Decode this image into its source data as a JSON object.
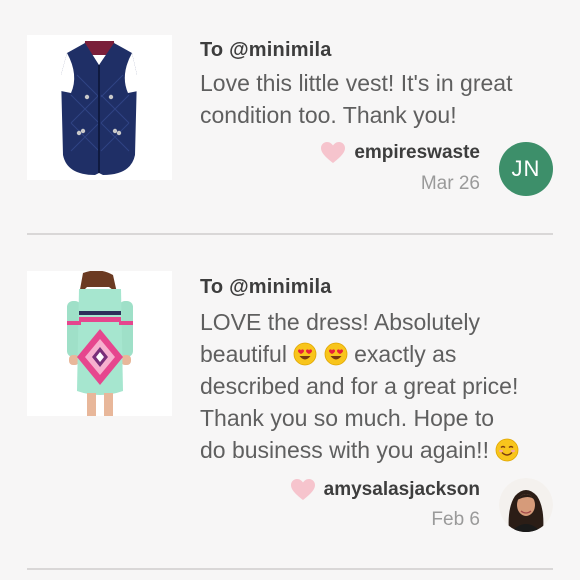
{
  "reviews": [
    {
      "to": "To @minimila",
      "message_lines": [
        "Love this little vest! It's in great",
        "condition too. Thank you!"
      ],
      "author": "empireswaste",
      "date": "Mar 26",
      "avatar_initials": "JN",
      "avatar_color": "#3d8f6a",
      "thumbnail_icon": "navy-quilted-vest-image"
    },
    {
      "to": "To @minimila",
      "message_lines": [
        "LOVE the dress! Absolutely",
        "beautiful",
        "exactly as",
        "described and for a great price!",
        "Thank you so much. Hope to",
        "do business with you again!!"
      ],
      "author": "amysalasjackson",
      "date": "Feb 6",
      "avatar_icon": "user-photo-avatar",
      "thumbnail_icon": "aztec-print-dress-image"
    }
  ],
  "colors": {
    "background": "#f7f6f6",
    "heart": "#f6c4cd",
    "divider": "#d9d7d7"
  }
}
